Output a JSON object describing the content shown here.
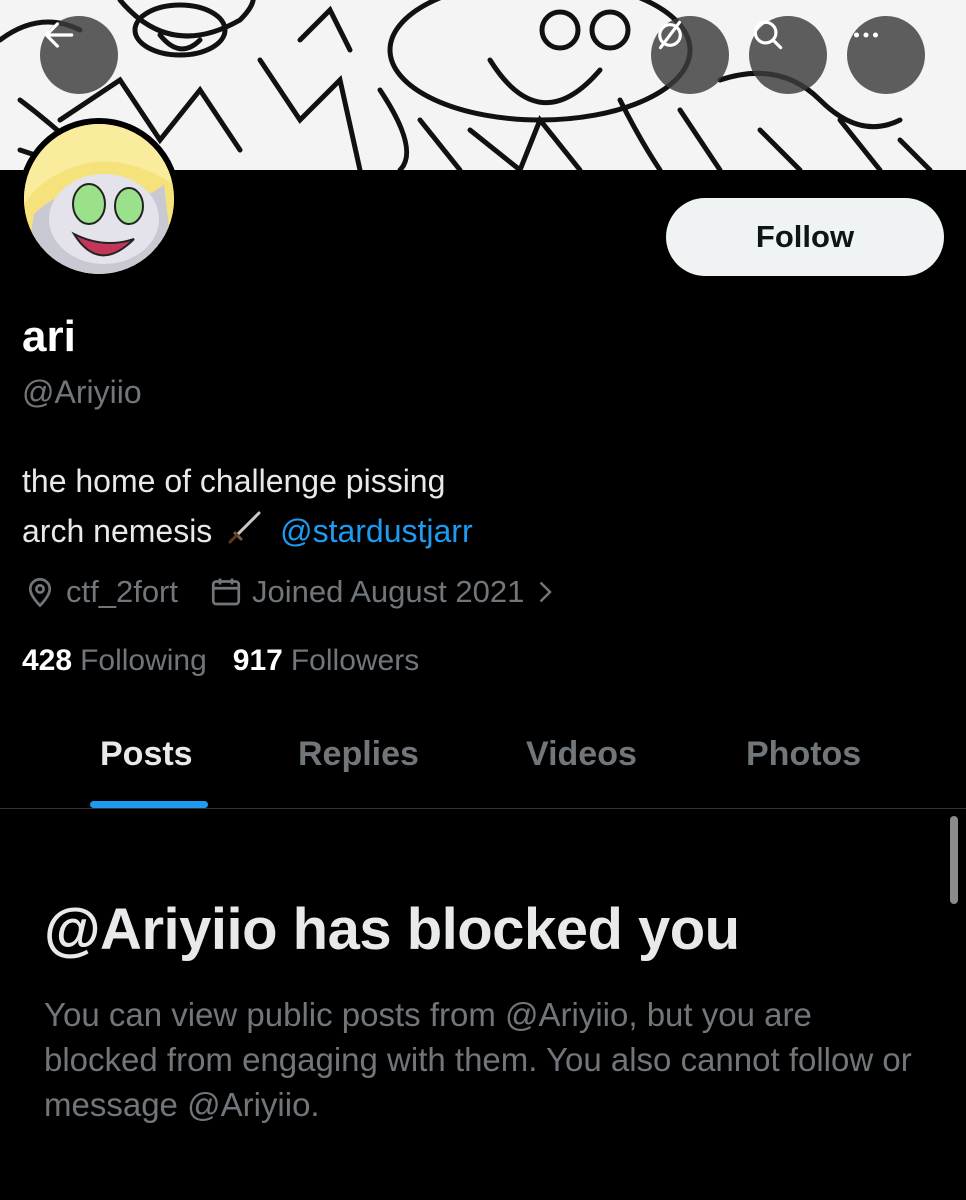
{
  "header": {
    "back_icon": "arrow-left-icon",
    "grok_icon": "grok-icon",
    "search_icon": "search-icon",
    "more_icon": "more-horizontal-icon"
  },
  "profile": {
    "follow_label": "Follow",
    "display_name": "ari",
    "handle": "@Ariyiio",
    "bio_line1": "the home of challenge pissing",
    "bio_line2": "arch nemesis",
    "bio_emoji": "dagger-icon",
    "bio_mention": "@stardustjarr",
    "location": "ctf_2fort",
    "joined": "Joined August 2021",
    "following_count": "428",
    "following_label": "Following",
    "followers_count": "917",
    "followers_label": "Followers"
  },
  "tabs": [
    {
      "label": "Posts",
      "active": true
    },
    {
      "label": "Replies",
      "active": false
    },
    {
      "label": "Videos",
      "active": false
    },
    {
      "label": "Photos",
      "active": false
    }
  ],
  "blocked": {
    "title": "@Ariyiio has blocked you",
    "message": "You can view public posts from @Ariyiio, but you are blocked from engaging with them. You also cannot follow or message @Ariyiio."
  },
  "colors": {
    "accent": "#1d9bf0",
    "background": "#000000",
    "secondary_text": "#71767b"
  }
}
